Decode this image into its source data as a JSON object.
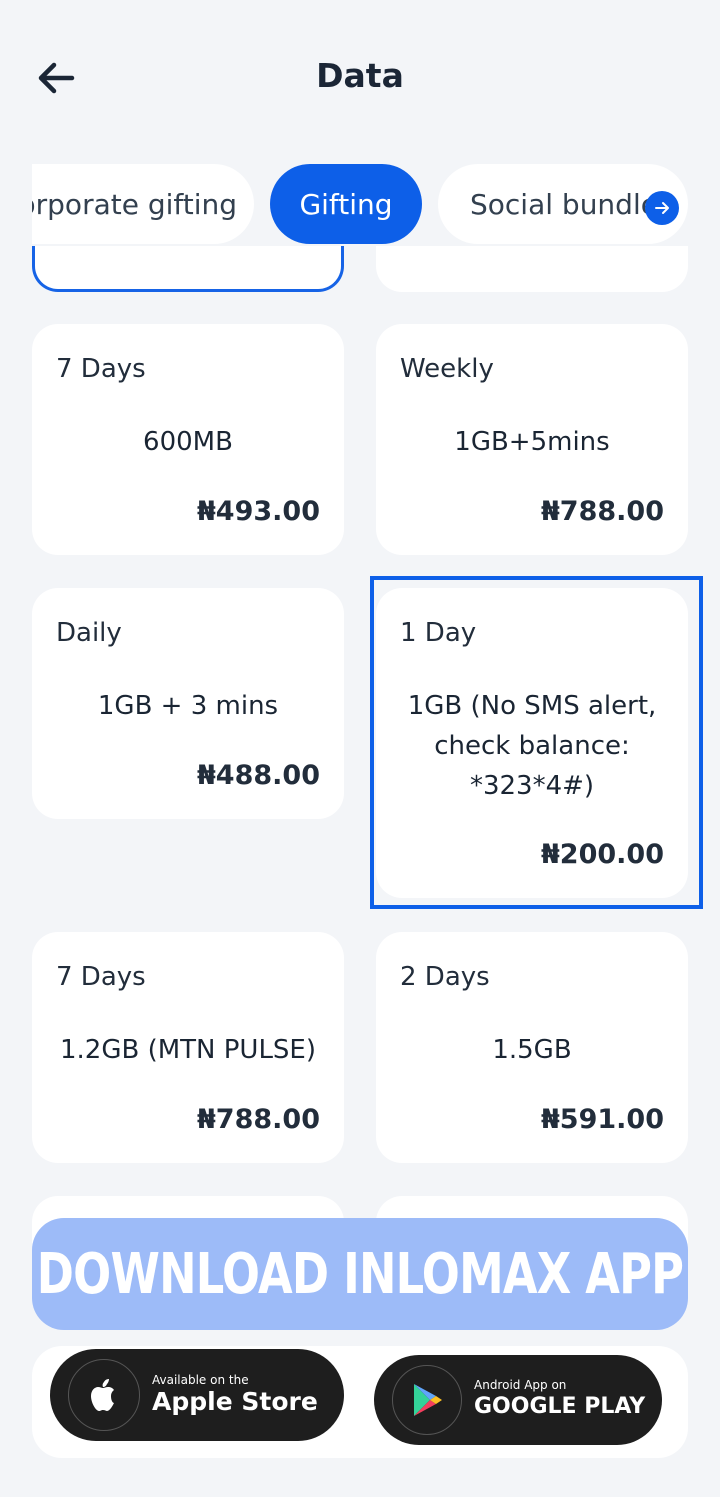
{
  "header": {
    "title": "Data"
  },
  "tabs": [
    {
      "label": "Corporate gifting"
    },
    {
      "label": "Gifting"
    },
    {
      "label": "Social bundle"
    }
  ],
  "plans": [
    {
      "duration": "7 Days",
      "size": "600MB",
      "price": "₦493.00"
    },
    {
      "duration": "Weekly",
      "size": "1GB+5mins",
      "price": "₦788.00"
    },
    {
      "duration": "Daily",
      "size": "1GB + 3 mins",
      "price": "₦488.00"
    },
    {
      "duration": "1 Day",
      "size": "1GB (No SMS alert, check balance: *323*4#)",
      "price": "₦200.00"
    },
    {
      "duration": "7 Days",
      "size": "1.2GB (MTN PULSE)",
      "price": "₦788.00"
    },
    {
      "duration": "2 Days",
      "size": "1.5GB",
      "price": "₦591.00"
    }
  ],
  "banner": {
    "text": "DOWNLOAD INLOMAX APP"
  },
  "stores": {
    "apple": {
      "small": "Available on the",
      "big": "Apple Store"
    },
    "google": {
      "small": "Android App on",
      "big": "GOOGLE PLAY"
    }
  },
  "colors": {
    "accent": "#0d5fe8",
    "banner": "#9dbbf8",
    "background": "#f3f5f8"
  }
}
